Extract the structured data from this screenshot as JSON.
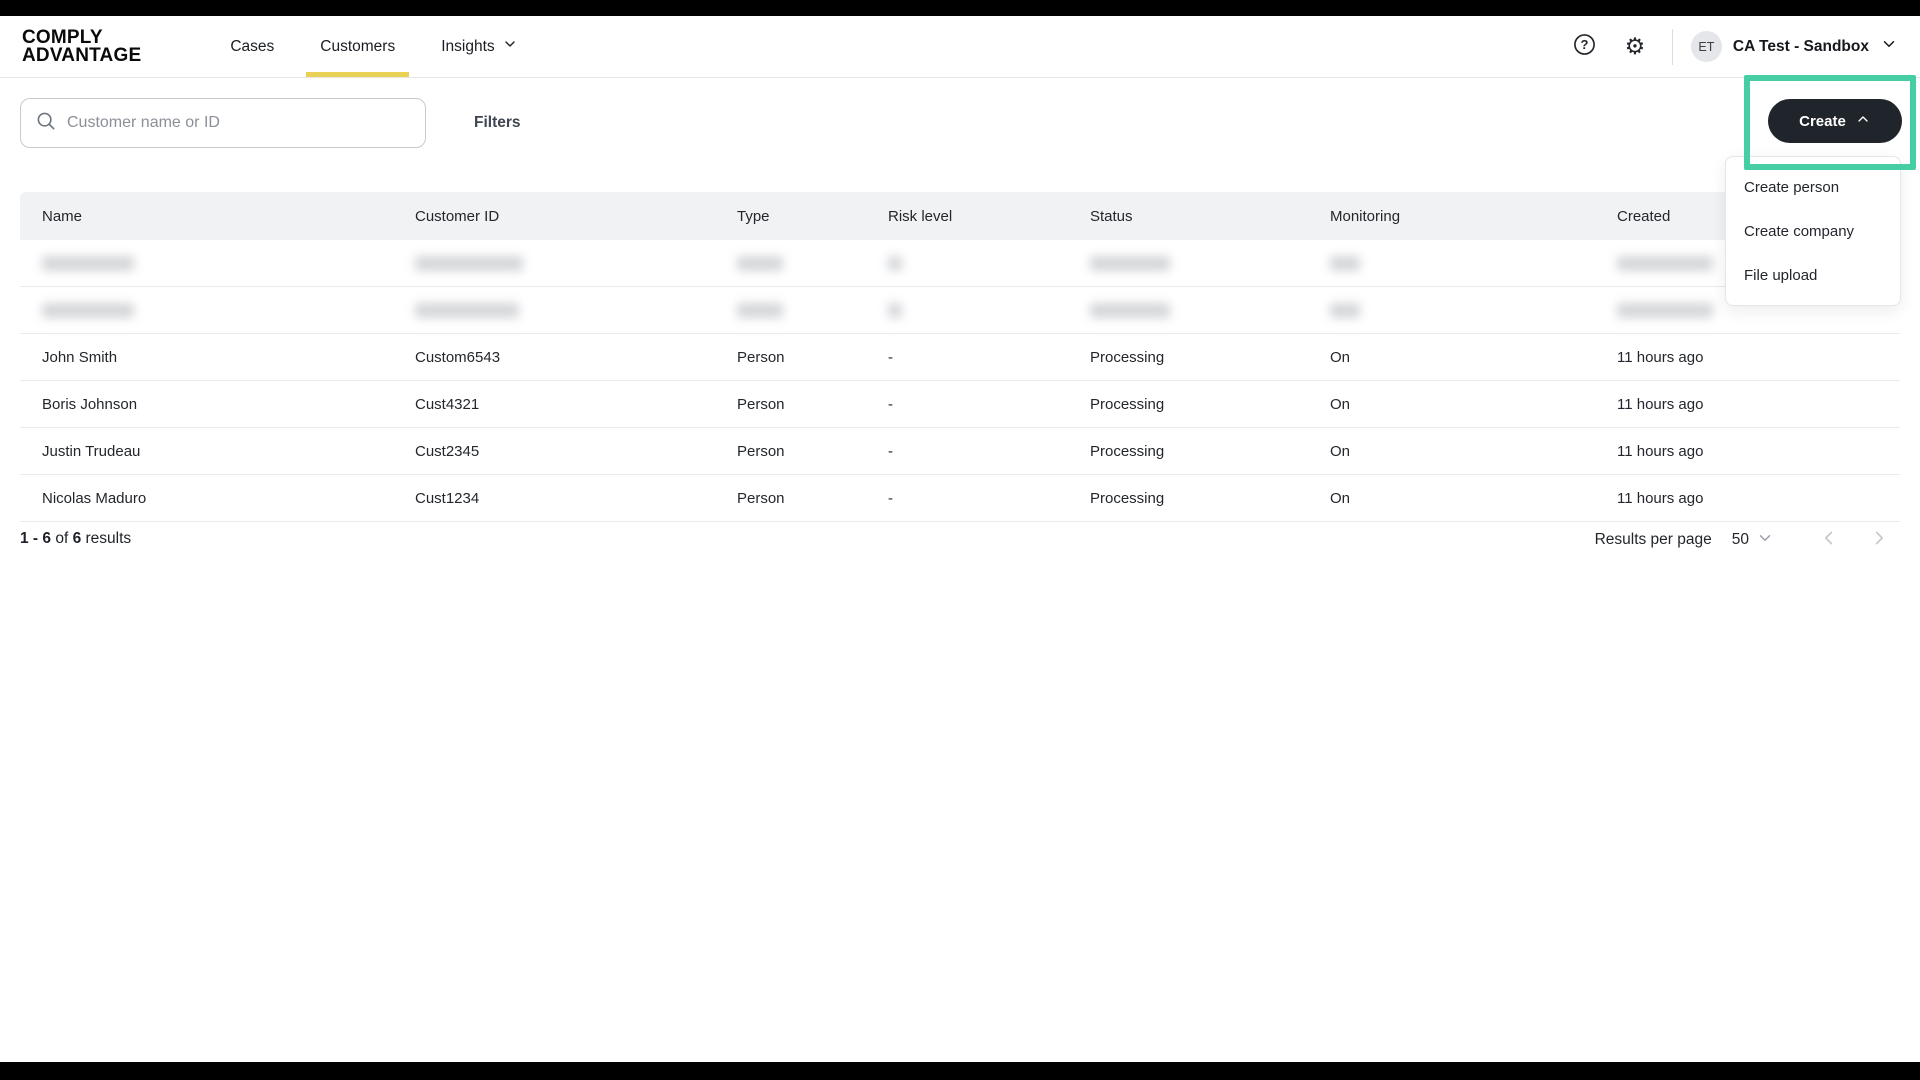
{
  "topbar": {
    "logo": {
      "line1": "COMPLY",
      "line2": "ADVANTAGE"
    },
    "tabs": [
      {
        "label": "Cases"
      },
      {
        "label": "Customers"
      },
      {
        "label": "Insights"
      }
    ],
    "account": {
      "initials": "ET",
      "name": "CA Test - Sandbox"
    }
  },
  "toolbar": {
    "search_placeholder": "Customer name or ID",
    "filters_label": "Filters",
    "create_label": "Create"
  },
  "create_menu": {
    "items": [
      "Create person",
      "Create company",
      "File upload"
    ]
  },
  "table": {
    "columns": [
      "Name",
      "Customer ID",
      "Type",
      "Risk level",
      "Status",
      "Monitoring",
      "Created"
    ],
    "redacted_row_count": 2,
    "rows": [
      {
        "name": "John Smith",
        "customer_id": "Custom6543",
        "type": "Person",
        "risk_level": "-",
        "status": "Processing",
        "monitoring": "On",
        "created": "11 hours ago"
      },
      {
        "name": "Boris Johnson",
        "customer_id": "Cust4321",
        "type": "Person",
        "risk_level": "-",
        "status": "Processing",
        "monitoring": "On",
        "created": "11 hours ago"
      },
      {
        "name": "Justin Trudeau",
        "customer_id": "Cust2345",
        "type": "Person",
        "risk_level": "-",
        "status": "Processing",
        "monitoring": "On",
        "created": "11 hours ago"
      },
      {
        "name": "Nicolas Maduro",
        "customer_id": "Cust1234",
        "type": "Person",
        "risk_level": "-",
        "status": "Processing",
        "monitoring": "On",
        "created": "11 hours ago"
      }
    ]
  },
  "footer": {
    "range_text": "1 - 6",
    "of_text": "of",
    "total_text": "6",
    "results_text": "results",
    "results_per_page_label": "Results per page",
    "results_per_page_value": "50"
  },
  "colors": {
    "accent_yellow": "#E8D155",
    "highlight_green": "#45CDA4",
    "button_dark": "#20242B",
    "header_row_bg": "#F1F2F4"
  }
}
